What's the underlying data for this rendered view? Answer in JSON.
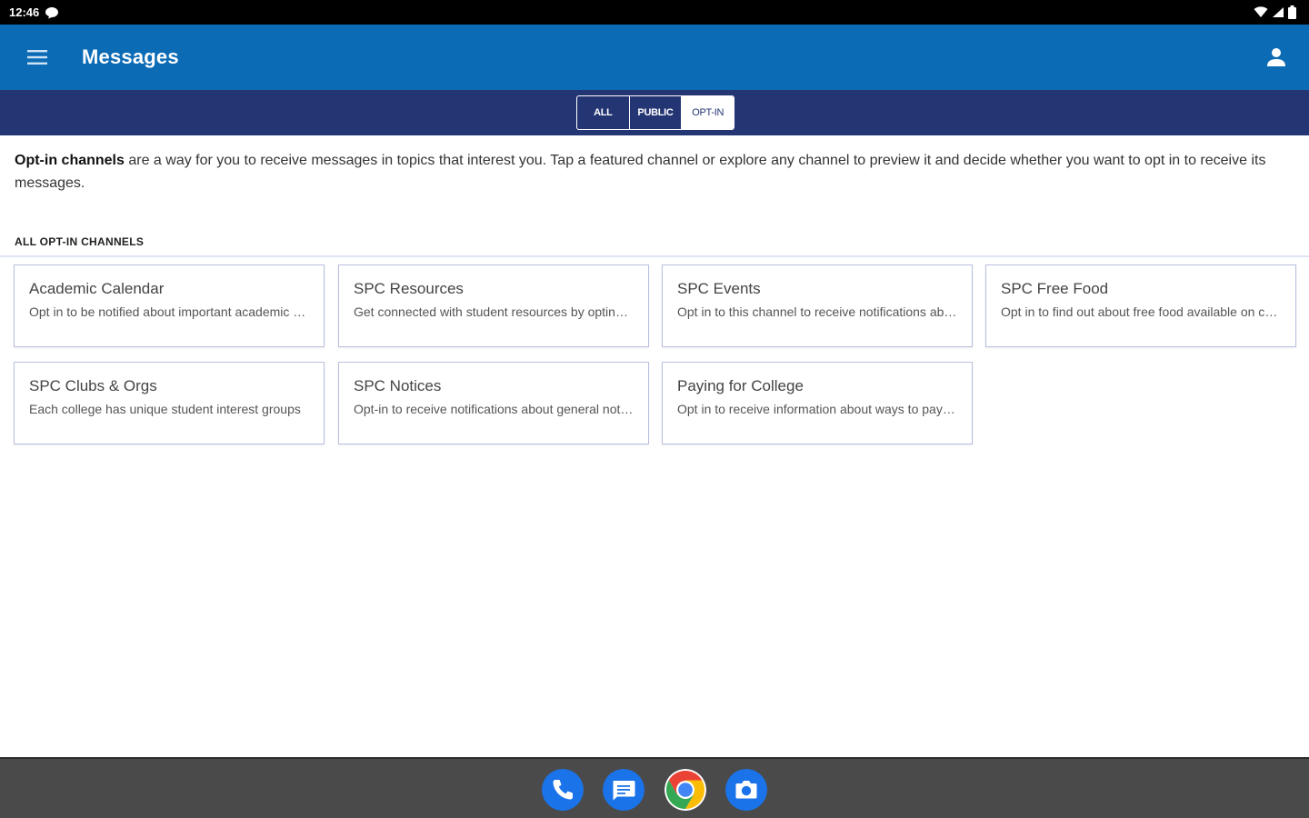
{
  "status": {
    "time": "12:46"
  },
  "app_bar": {
    "title": "Messages"
  },
  "tabs": [
    {
      "label": "ALL"
    },
    {
      "label": "PUBLIC"
    },
    {
      "label": "OPT-IN"
    }
  ],
  "intro": {
    "bold": "Opt-in channels",
    "rest": " are a way for you to receive messages in topics that interest you. Tap a featured channel or explore any channel to preview it and decide whether you want to opt in to receive its messages."
  },
  "section": {
    "header": "ALL OPT-IN CHANNELS"
  },
  "channels": [
    {
      "title": "Academic Calendar",
      "desc": "Opt in to be notified about important academic dates"
    },
    {
      "title": "SPC Resources",
      "desc": "Get connected with student resources by opting in"
    },
    {
      "title": "SPC Events",
      "desc": "Opt in to this channel to receive notifications about events"
    },
    {
      "title": "SPC Free Food",
      "desc": "Opt in to find out about free food available on campus"
    },
    {
      "title": "SPC Clubs & Orgs",
      "desc": "Each college has unique student interest groups"
    },
    {
      "title": "SPC Notices",
      "desc": "Opt-in to receive notifications about general notices"
    },
    {
      "title": "Paying for College",
      "desc": "Opt in to receive information about ways to pay for college"
    }
  ],
  "colors": {
    "app_bar": "#0b6bb5",
    "tab_bar": "#243574",
    "card_border": "#b9c0e0"
  },
  "dock": [
    {
      "icon": "phone-icon"
    },
    {
      "icon": "messages-icon"
    },
    {
      "icon": "chrome-icon"
    },
    {
      "icon": "camera-icon"
    }
  ]
}
